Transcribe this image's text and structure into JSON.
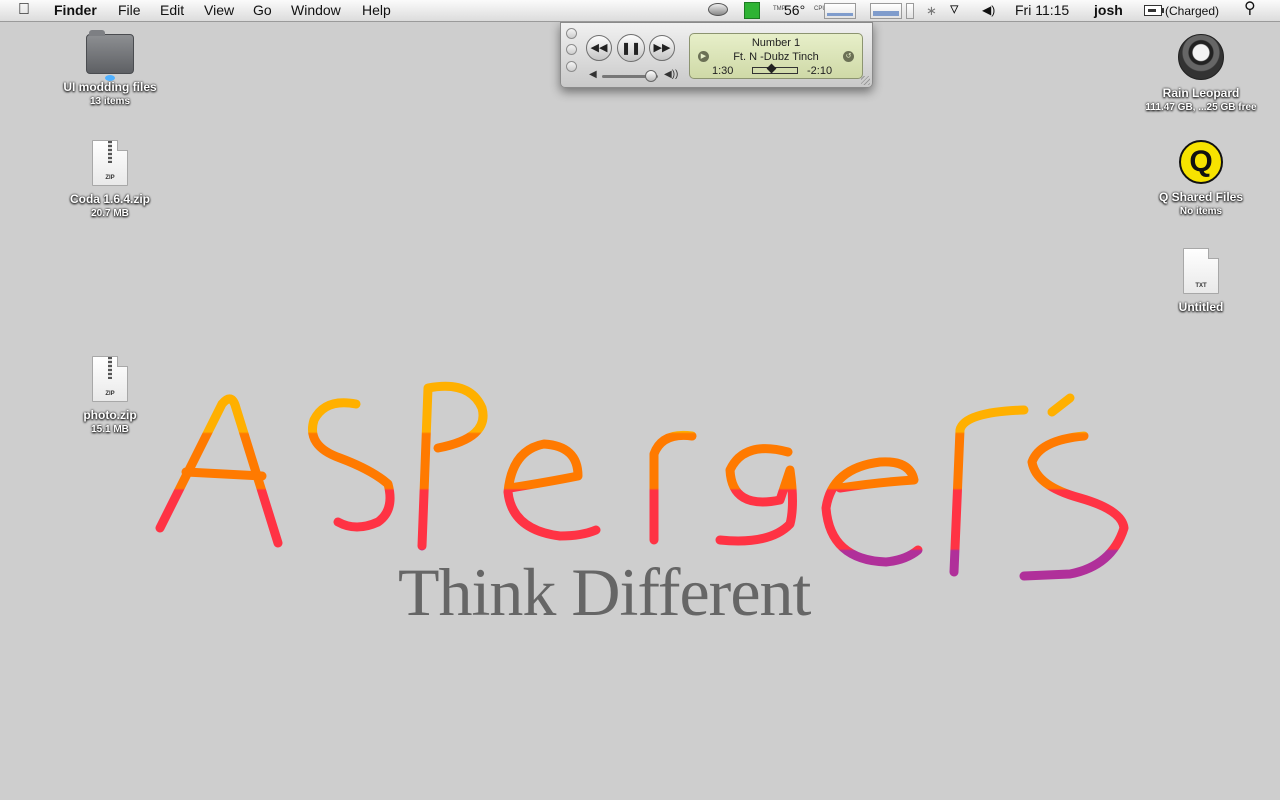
{
  "menubar": {
    "app_name": "Finder",
    "items": [
      "File",
      "Edit",
      "View",
      "Go",
      "Window",
      "Help"
    ],
    "temp_label": "TMP",
    "temperature": "56°",
    "cpu_label": "CPU",
    "clock": "Fri 11:15",
    "user": "josh",
    "battery_status": "(Charged)"
  },
  "player": {
    "track_title": "Number 1",
    "track_info": "Ft. N -Dubz   Tinch",
    "elapsed": "1:30",
    "remaining": "-2:10",
    "progress_fraction": 0.41,
    "volume_fraction": 0.85
  },
  "desktop_left": [
    {
      "name": "UI modding files",
      "info": "13 items",
      "kind": "folder"
    },
    {
      "name": "Coda 1.6.4.zip",
      "info": "20.7 MB",
      "kind": "zip"
    },
    {
      "name": "photo.zip",
      "info": "15.1 MB",
      "kind": "zip"
    }
  ],
  "desktop_right": [
    {
      "name": "Rain Leopard",
      "info": "111.47 GB, ...25 GB free",
      "kind": "disk"
    },
    {
      "name": "Q Shared Files",
      "info": "No items",
      "kind": "share"
    },
    {
      "name": "Untitled",
      "info": "",
      "kind": "txt"
    }
  ],
  "icon_ext": {
    "zip": "ZIP",
    "txt": "TXT"
  },
  "wallpaper": {
    "tagline": "Think Different"
  },
  "colors": {
    "desktop": "#cecece",
    "gradient_top": "#ffb000",
    "gradient_mid": "#ff6a00",
    "gradient_low": "#ff2d48",
    "gradient_bottom": "#b0309a",
    "tagline": "#666666"
  }
}
